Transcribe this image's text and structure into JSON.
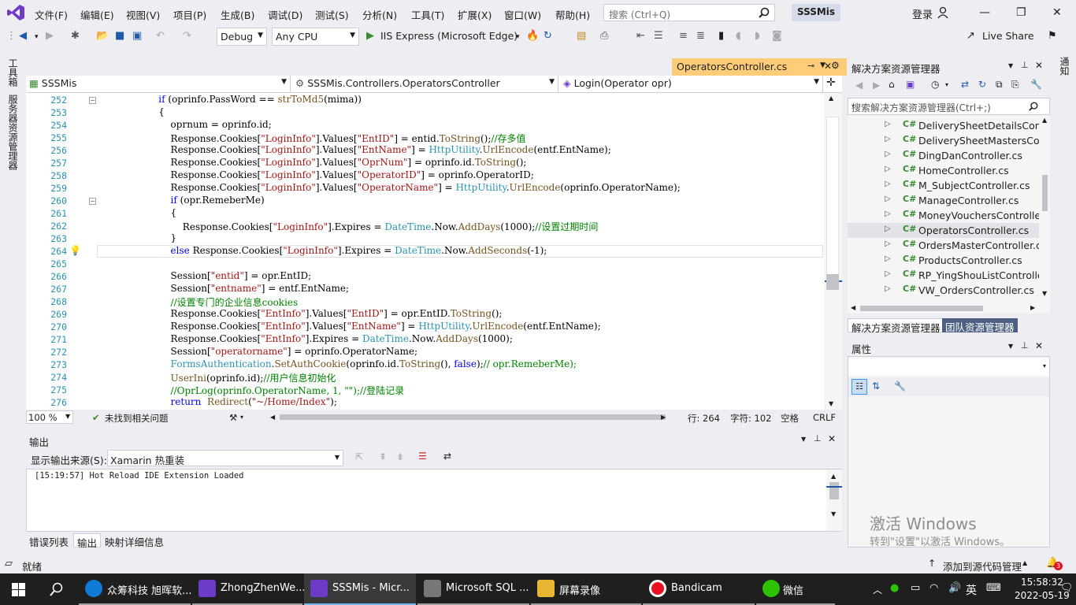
{
  "menubar": {
    "items": [
      "文件(F)",
      "编辑(E)",
      "视图(V)",
      "项目(P)",
      "生成(B)",
      "调试(D)",
      "测试(S)",
      "分析(N)",
      "工具(T)",
      "扩展(X)",
      "窗口(W)",
      "帮助(H)"
    ],
    "search_placeholder": "搜索 (Ctrl+Q)",
    "app_name": "SSSMis",
    "login": "登录"
  },
  "toolbar": {
    "config": "Debug",
    "platform": "Any CPU",
    "run_target": "IIS Express (Microsoft Edge)",
    "live_share": "Live Share"
  },
  "left_strip": {
    "toolbox": "工具箱",
    "server_explorer": "服务器资源管理器"
  },
  "editor": {
    "tab_title": "OperatorsController.cs",
    "nav_project": "SSSMis",
    "nav_class": "SSSMis.Controllers.OperatorsController",
    "nav_member": "Login(Operator opr)",
    "line_numbers": [
      "252",
      "253",
      "254",
      "255",
      "256",
      "257",
      "258",
      "259",
      "260",
      "261",
      "262",
      "263",
      "264",
      "265",
      "266",
      "267",
      "268",
      "269",
      "270",
      "271",
      "272",
      "273",
      "274",
      "275",
      "276"
    ],
    "zoom": "100 %",
    "issues": "未找到相关问题",
    "position_line": "行: 264",
    "position_char": "字符: 102",
    "indent_mode": "空格",
    "line_ending": "CRLF"
  },
  "output": {
    "title": "输出",
    "source_label": "显示输出来源(S):",
    "source_value": "Xamarin 热重装",
    "log_line": "[15:19:57]  Hot Reload IDE Extension Loaded",
    "tabs": [
      "错误列表",
      "输出",
      "映射详细信息"
    ]
  },
  "solution_explorer": {
    "title": "解决方案资源管理器",
    "search_placeholder": "搜索解决方案资源管理器(Ctrl+;)",
    "items": [
      "DeliverySheetDetailsContr",
      "DeliverySheetMastersCont",
      "DingDanController.cs",
      "HomeController.cs",
      "M_SubjectController.cs",
      "ManageController.cs",
      "MoneyVouchersController",
      "OperatorsController.cs",
      "OrdersMasterController.c",
      "ProductsController.cs",
      "RP_YingShouListController",
      "VW_OrdersController.cs"
    ],
    "selected": "OperatorsController.cs",
    "bottom_tabs": [
      "解决方案资源管理器",
      "团队资源管理器"
    ]
  },
  "properties": {
    "title": "属性"
  },
  "right_strip": {
    "notifications": "通知"
  },
  "watermark": {
    "line1": "激活 Windows",
    "line2": "转到\"设置\"以激活 Windows。"
  },
  "status_bar": {
    "ready": "就绪",
    "add_source": "添加到源代码管理",
    "notif_count": "3"
  },
  "taskbar": {
    "apps": [
      {
        "label": "众筹科技 旭晖软...",
        "icon": "edge-icon"
      },
      {
        "label": "ZhongZhenWe...",
        "icon": "vs-icon"
      },
      {
        "label": "SSSMis - Micr...",
        "icon": "vs-icon"
      },
      {
        "label": "Microsoft SQL ...",
        "icon": "sql-icon"
      },
      {
        "label": "屏幕录像",
        "icon": "folder-icon"
      },
      {
        "label": "Bandicam",
        "icon": "record-icon"
      },
      {
        "label": "微信",
        "icon": "wechat-icon"
      }
    ],
    "ime": "英",
    "time": "15:58:32",
    "date": "2022-05-19"
  }
}
